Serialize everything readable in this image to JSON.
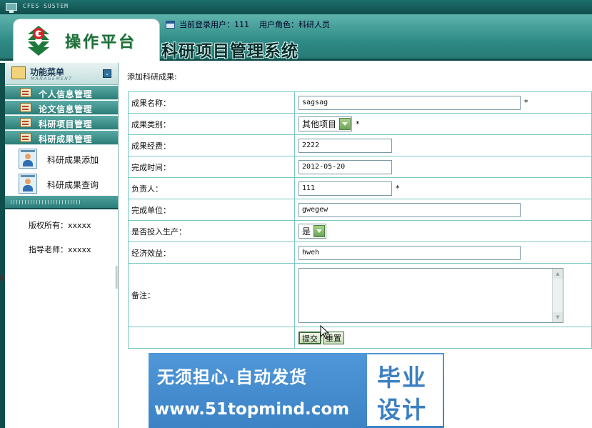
{
  "system_bar": {
    "text": "CFES SUSTEM"
  },
  "header": {
    "logo_text": "操作平台",
    "user_label": "当前登录用户：111",
    "role_label": "用户角色：科研人员",
    "system_title": "科研项目管理系统"
  },
  "sidebar": {
    "menu_title": "功能菜单",
    "menu_subtitle": "MANAGEMENT",
    "items": [
      {
        "label": "个人信息管理"
      },
      {
        "label": "论文信息管理"
      },
      {
        "label": "科研项目管理"
      },
      {
        "label": "科研成果管理"
      }
    ],
    "sub_items": [
      {
        "label": "科研成果添加",
        "icon": "user-card-icon"
      },
      {
        "label": "科研成果查询",
        "icon": "user-card-icon"
      }
    ],
    "copyright": "版权所有：xxxxx",
    "advisor": "指导老师：xxxxx"
  },
  "main": {
    "breadcrumb": "添加科研成果:",
    "fields": {
      "name": {
        "label": "成果名称：",
        "value": "sagsag",
        "required": "*"
      },
      "category": {
        "label": "成果类别：",
        "value": "其他项目",
        "required": "*"
      },
      "funding": {
        "label": "成果经费：",
        "value": "2222"
      },
      "date": {
        "label": "完成时间：",
        "value": "2012-05-20"
      },
      "leader": {
        "label": "负责人：",
        "value": "111",
        "required": "*"
      },
      "unit": {
        "label": "完成单位：",
        "value": "gwegew"
      },
      "production": {
        "label": "是否投入生产：",
        "value": "是"
      },
      "benefit": {
        "label": "经济效益：",
        "value": "hweh"
      },
      "note": {
        "label": "备注：",
        "value": ""
      }
    },
    "buttons": {
      "submit": "提交",
      "reset": "重置"
    }
  },
  "banner": {
    "line1": "无须担心.自动发货",
    "line2": "www.51topmind.com",
    "box_line1": "毕业",
    "box_line2": "设计"
  },
  "colors": {
    "accent": "#2b7d78",
    "dark": "#0f4d4b",
    "border": "#79c7c4",
    "banner": "#3c83c6"
  }
}
